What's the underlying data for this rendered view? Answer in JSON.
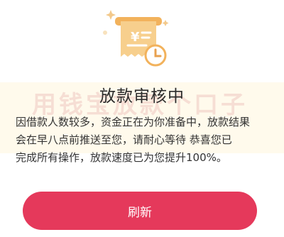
{
  "dialog": {
    "title": "放款审核中",
    "watermark": "用钱宝放款个口子",
    "message": "因借款人数较多，资金正在为你准备中，放款结果\n会在早八点前推送至您，请耐心等待 恭喜您已\n完成所有操作，放款速度已为您提升100%。",
    "refresh_label": "刷新",
    "accent_color": "#e5395b",
    "illustration_icon": "receipt-clock-icon",
    "currency_symbol": "¥"
  }
}
